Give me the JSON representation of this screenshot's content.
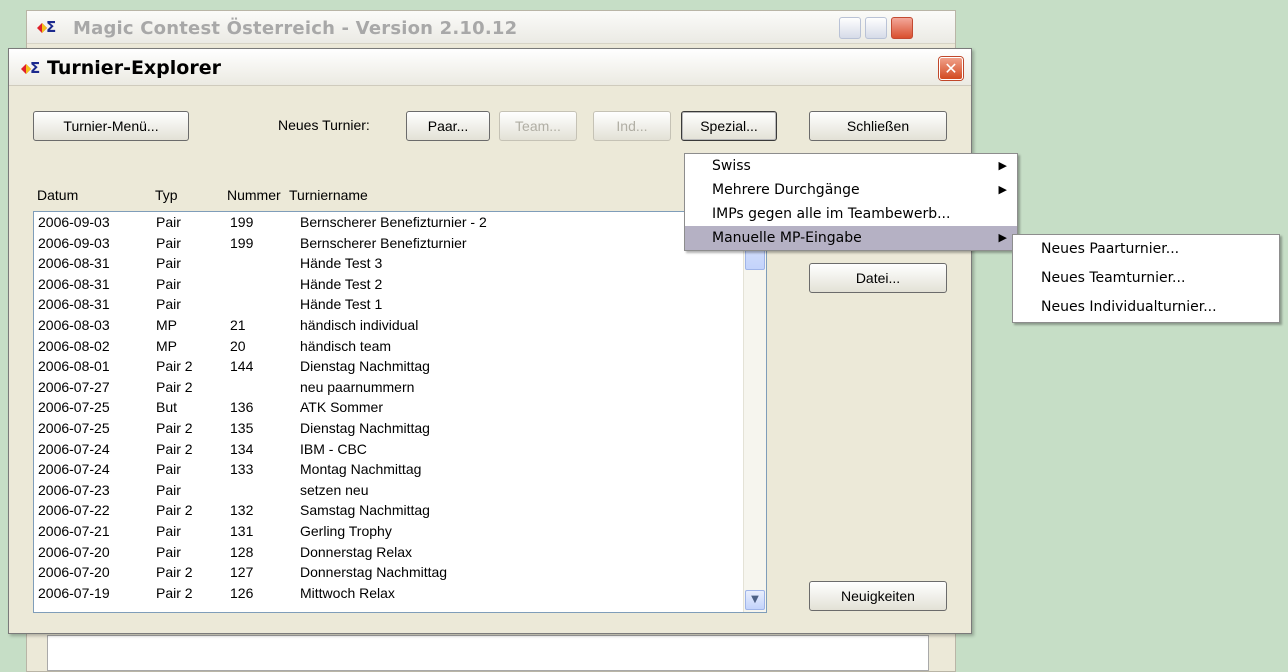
{
  "main_window": {
    "title": "Magic Contest Österreich - Version 2.10.12"
  },
  "dialog": {
    "title": "Turnier-Explorer",
    "close_glyph": "✕",
    "toolbar": {
      "turnier_menu": "Turnier-Menü...",
      "neues_turnier_label": "Neues Turnier:",
      "paar": "Paar...",
      "team": "Team...",
      "ind": "Ind...",
      "spezial": "Spezial...",
      "schliessen": "Schließen"
    },
    "side_buttons": {
      "datei": "Datei...",
      "neuigkeiten": "Neuigkeiten"
    },
    "columns": [
      "Datum",
      "Typ",
      "Nummer",
      "Turniername"
    ],
    "rows": [
      [
        "2006-09-03",
        "Pair",
        "199",
        "Bernscherer Benefizturnier - 2"
      ],
      [
        "2006-09-03",
        "Pair",
        "199",
        "Bernscherer Benefizturnier"
      ],
      [
        "2006-08-31",
        "Pair",
        "",
        "Hände Test 3"
      ],
      [
        "2006-08-31",
        "Pair",
        "",
        "Hände Test 2"
      ],
      [
        "2006-08-31",
        "Pair",
        "",
        "Hände Test 1"
      ],
      [
        "2006-08-03",
        "MP",
        "21",
        "händisch individual"
      ],
      [
        "2006-08-02",
        "MP",
        "20",
        "händisch team"
      ],
      [
        "2006-08-01",
        "Pair 2",
        "144",
        "Dienstag Nachmittag"
      ],
      [
        "2006-07-27",
        "Pair 2",
        "",
        "neu paarnummern"
      ],
      [
        "2006-07-25",
        "But",
        "136",
        "ATK Sommer"
      ],
      [
        "2006-07-25",
        "Pair 2",
        "135",
        "Dienstag Nachmittag"
      ],
      [
        "2006-07-24",
        "Pair 2",
        "134",
        "IBM - CBC"
      ],
      [
        "2006-07-24",
        "Pair",
        "133",
        "Montag Nachmittag"
      ],
      [
        "2006-07-23",
        "Pair",
        "",
        "setzen neu"
      ],
      [
        "2006-07-22",
        "Pair 2",
        "132",
        "Samstag Nachmittag"
      ],
      [
        "2006-07-21",
        "Pair",
        "131",
        "Gerling Trophy"
      ],
      [
        "2006-07-20",
        "Pair",
        "128",
        "Donnerstag Relax"
      ],
      [
        "2006-07-20",
        "Pair 2",
        "127",
        "Donnerstag Nachmittag"
      ],
      [
        "2006-07-19",
        "Pair 2",
        "126",
        "Mittwoch Relax"
      ]
    ]
  },
  "spezial_menu": {
    "items": [
      {
        "label": "Swiss",
        "submenu": true
      },
      {
        "label": "Mehrere Durchgänge",
        "submenu": true
      },
      {
        "label": "IMPs gegen alle im Teambewerb...",
        "submenu": false
      },
      {
        "label": "Manuelle MP-Eingabe",
        "submenu": true,
        "highlighted": true
      }
    ]
  },
  "mp_submenu": {
    "items": [
      {
        "label": "Neues Paarturnier..."
      },
      {
        "label": "Neues Teamturnier..."
      },
      {
        "label": "Neues Individualturnier..."
      }
    ]
  },
  "colors": {
    "desktop": "#c6dec6",
    "menu_highlight": "#b5b1c4",
    "dialog_face": "#ece9d8"
  }
}
